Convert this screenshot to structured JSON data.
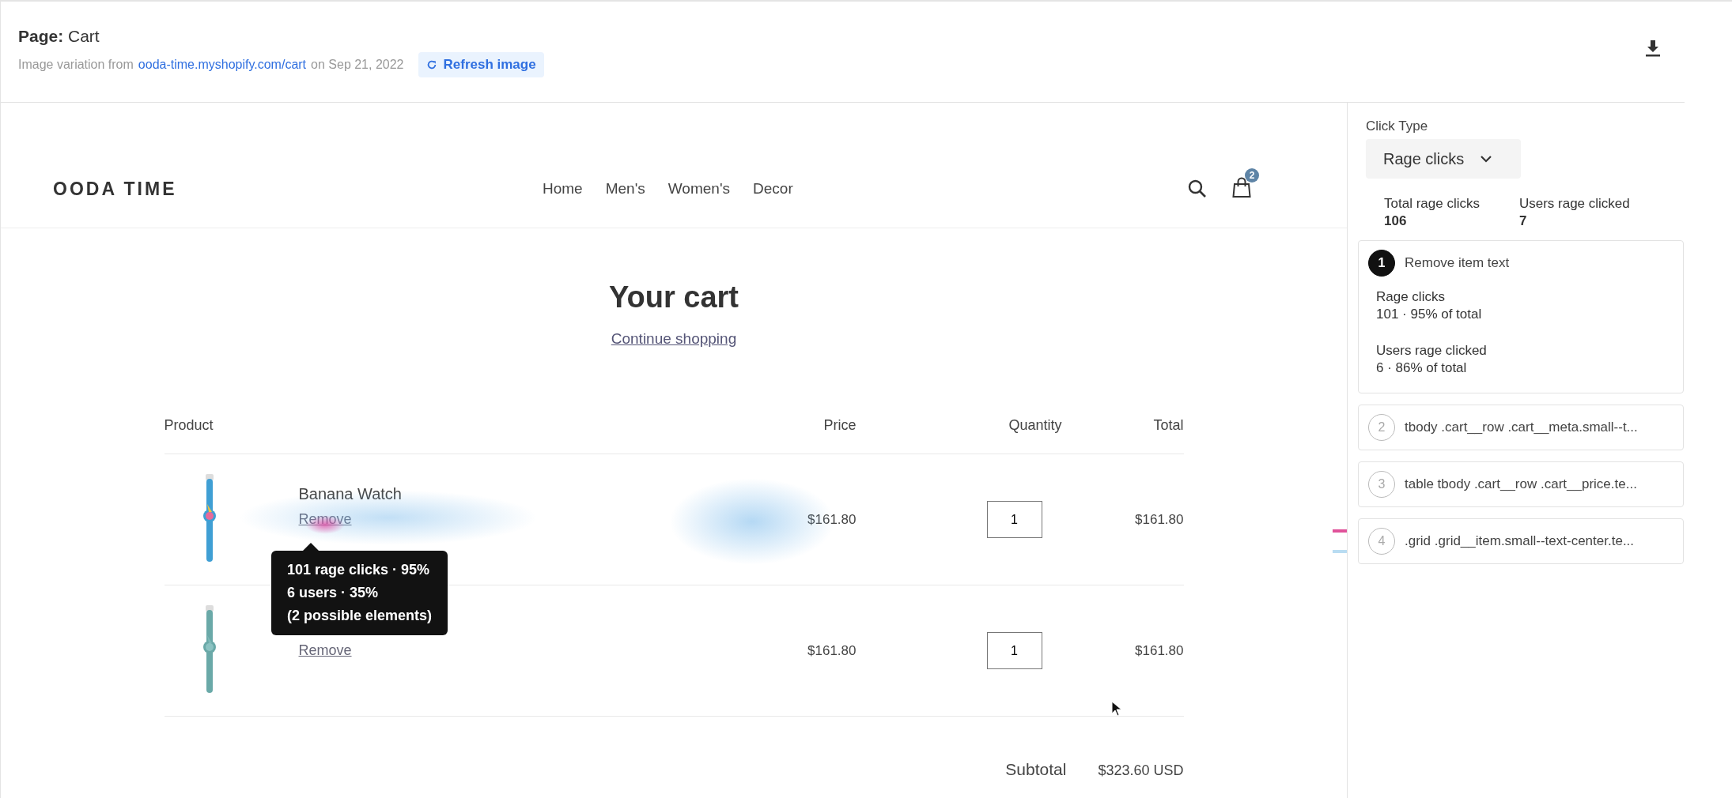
{
  "header": {
    "page_label": "Page:",
    "page_name": "Cart",
    "variation_prefix": "Image variation from",
    "variation_link": "ooda-time.myshopify.com/cart",
    "variation_date": "on Sep 21, 2022",
    "refresh_button": "Refresh image"
  },
  "store": {
    "logo": "OODA TIME",
    "nav": [
      "Home",
      "Men's",
      "Women's",
      "Decor"
    ],
    "cart_count": "2",
    "title": "Your cart",
    "continue_link": "Continue shopping",
    "columns": [
      "Product",
      "Price",
      "Quantity",
      "Total"
    ],
    "items": [
      {
        "name": "Banana Watch",
        "remove": "Remove",
        "price": "$161.80",
        "quantity": "1",
        "total": "$161.80"
      },
      {
        "remove": "Remove",
        "price": "$161.80",
        "quantity": "1",
        "total": "$161.80"
      }
    ],
    "subtotal_label": "Subtotal",
    "subtotal_value": "$323.60 USD"
  },
  "tooltip": {
    "lines": [
      "101 rage clicks · 95%",
      "6 users · 35%",
      "(2 possible elements)"
    ]
  },
  "panel": {
    "click_type_label": "Click Type",
    "click_type": "Rage clicks",
    "stats": [
      {
        "label": "Total rage clicks",
        "value": "106"
      },
      {
        "label": "Users rage clicked",
        "value": "7"
      }
    ],
    "elements": [
      {
        "number": "1",
        "title": "Remove item text",
        "selected": true,
        "details": [
          {
            "label": "Rage clicks",
            "value": "101 · 95% of total"
          },
          {
            "label": "Users rage clicked",
            "value": "6 · 86% of total"
          }
        ]
      },
      {
        "number": "2",
        "title": "tbody .cart__row .cart__meta.small--t...",
        "selected": false
      },
      {
        "number": "3",
        "title": "table tbody .cart__row .cart__price.te...",
        "selected": false
      },
      {
        "number": "4",
        "title": ".grid .grid__item.small--text-center.te...",
        "selected": false
      }
    ]
  }
}
